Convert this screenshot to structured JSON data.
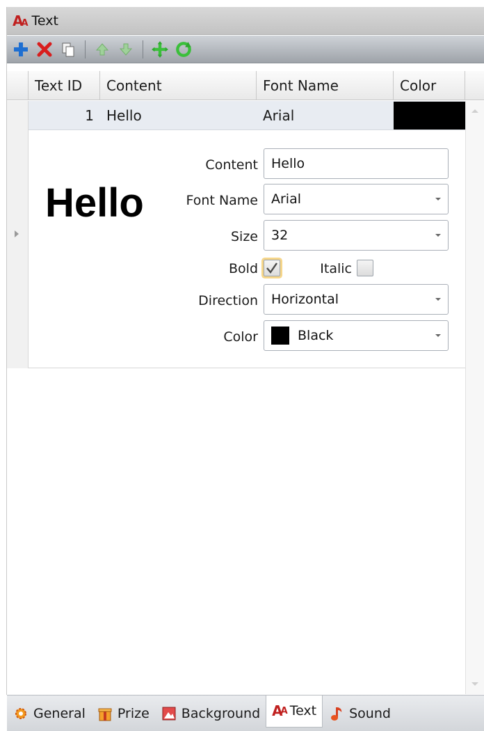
{
  "window": {
    "title": "Text",
    "icon": "text-font-icon"
  },
  "toolbar": {
    "buttons": [
      "add-icon",
      "delete-icon",
      "copy-icon",
      "move-up-icon",
      "move-down-icon",
      "move-icon",
      "refresh-icon"
    ]
  },
  "grid": {
    "columns": [
      "Text ID",
      "Content",
      "Font Name",
      "Color"
    ],
    "rows": [
      {
        "id": "1",
        "content": "Hello",
        "font": "Arial",
        "color": "#000000"
      }
    ]
  },
  "detail": {
    "preview_text": "Hello",
    "content_label": "Content",
    "content_value": "Hello",
    "font_label": "Font Name",
    "font_value": "Arial",
    "size_label": "Size",
    "size_value": "32",
    "bold_label": "Bold",
    "bold_checked": true,
    "italic_label": "Italic",
    "italic_checked": false,
    "direction_label": "Direction",
    "direction_value": "Horizontal",
    "color_label": "Color",
    "color_value": "Black",
    "color_swatch": "#000000"
  },
  "tabs": [
    {
      "label": "General",
      "icon": "gear-icon"
    },
    {
      "label": "Prize",
      "icon": "gift-icon"
    },
    {
      "label": "Background",
      "icon": "image-icon"
    },
    {
      "label": "Text",
      "icon": "text-font-icon",
      "active": true
    },
    {
      "label": "Sound",
      "icon": "music-note-icon"
    }
  ]
}
